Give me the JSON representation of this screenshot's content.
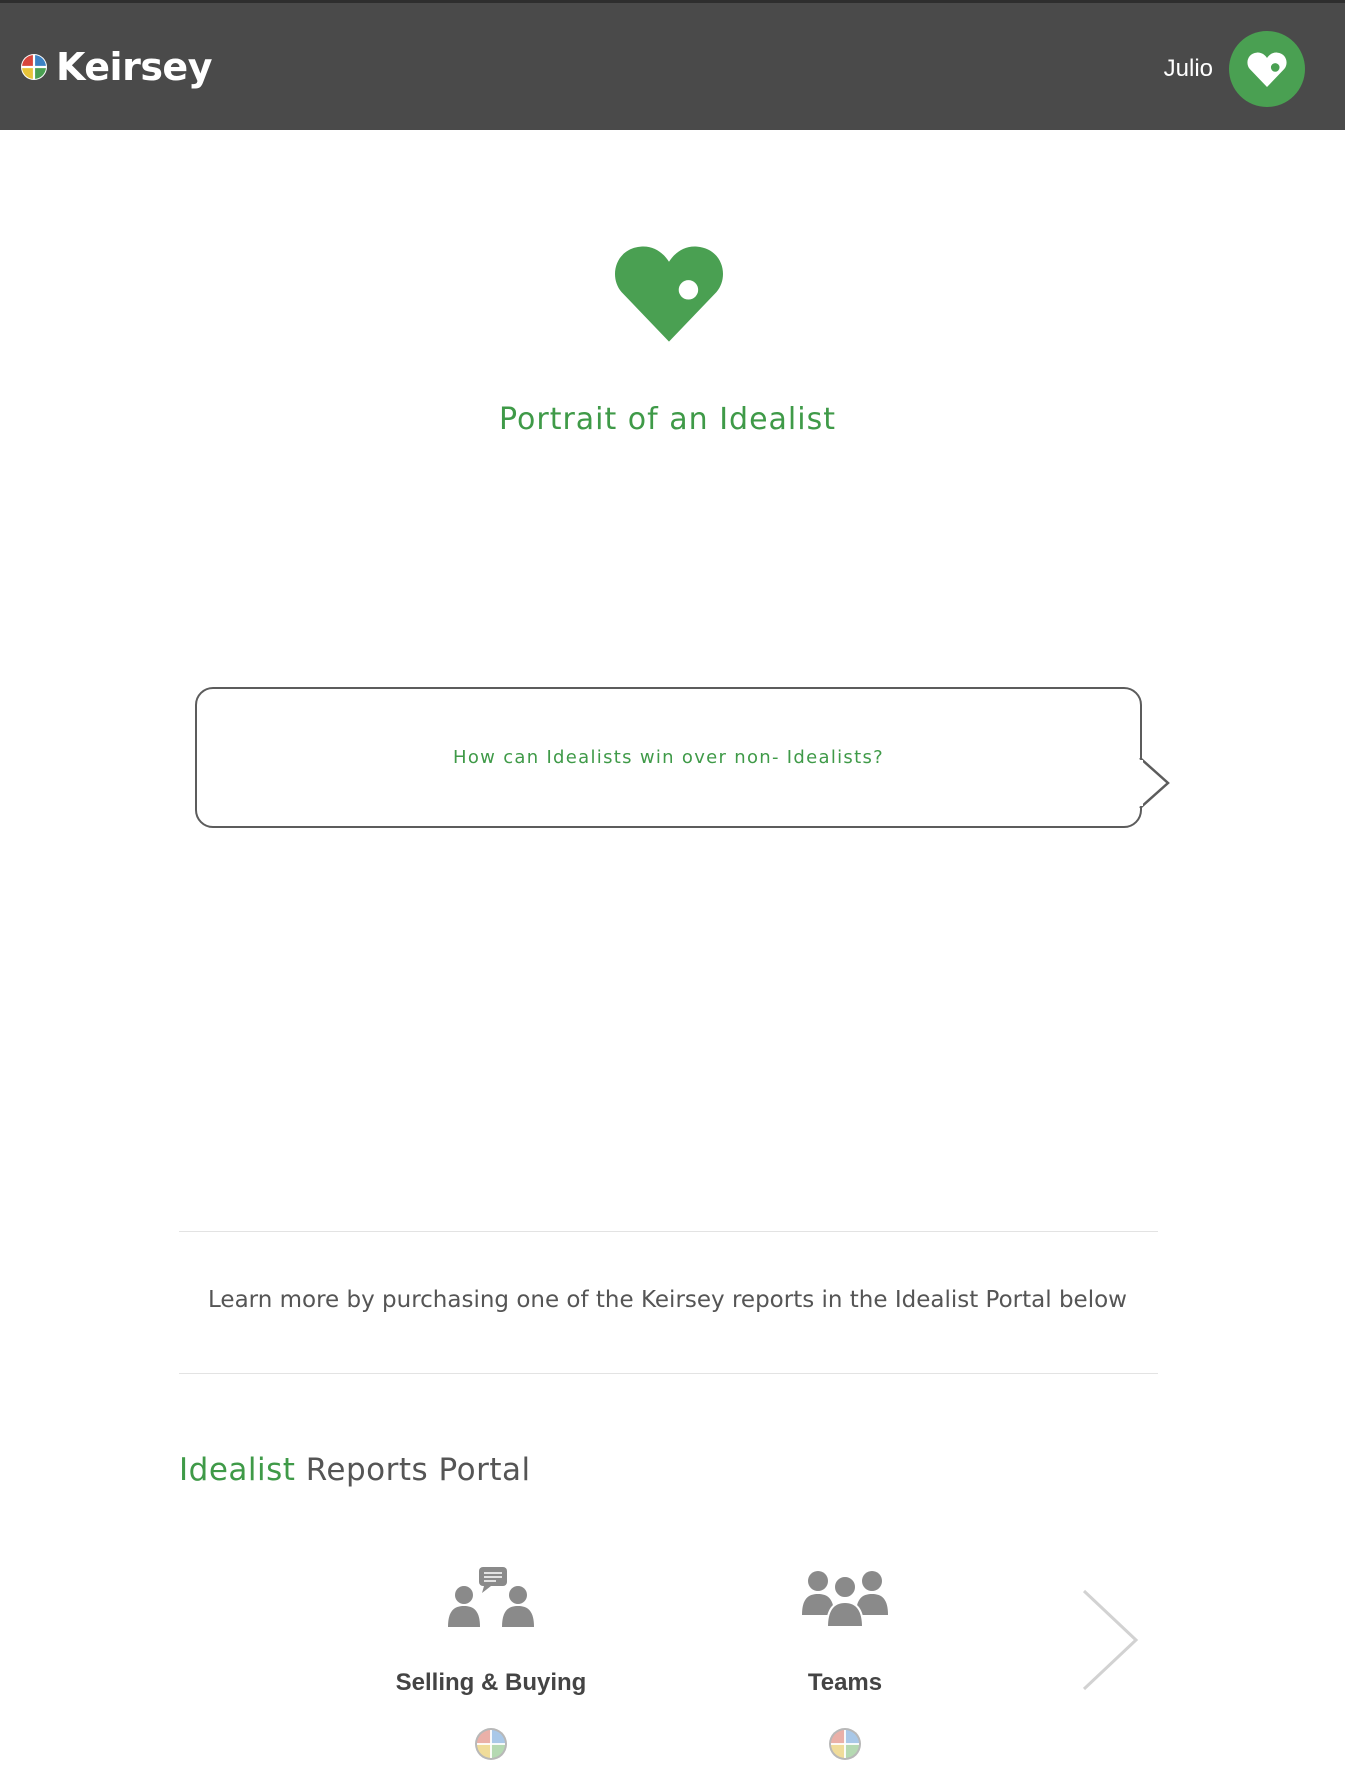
{
  "header": {
    "brand": "Keirsey",
    "user_name": "Julio"
  },
  "hero": {
    "icon": "heart-keyhole-icon",
    "title": "Portrait of an Idealist"
  },
  "question": {
    "text": "How can Idealists win over non- Idealists?"
  },
  "learn_more": "Learn more by purchasing one of the Keirsey reports in the Idealist Portal below",
  "portal": {
    "title_accent": "Idealist",
    "title_rest": " Reports Portal",
    "reports": [
      {
        "label": "Selling & Buying",
        "icon": "selling-buying-icon"
      },
      {
        "label": "Teams",
        "icon": "teams-icon"
      }
    ]
  },
  "colors": {
    "accent": "#3f9a48",
    "topbar": "#4a4a4a",
    "text": "#555555"
  }
}
